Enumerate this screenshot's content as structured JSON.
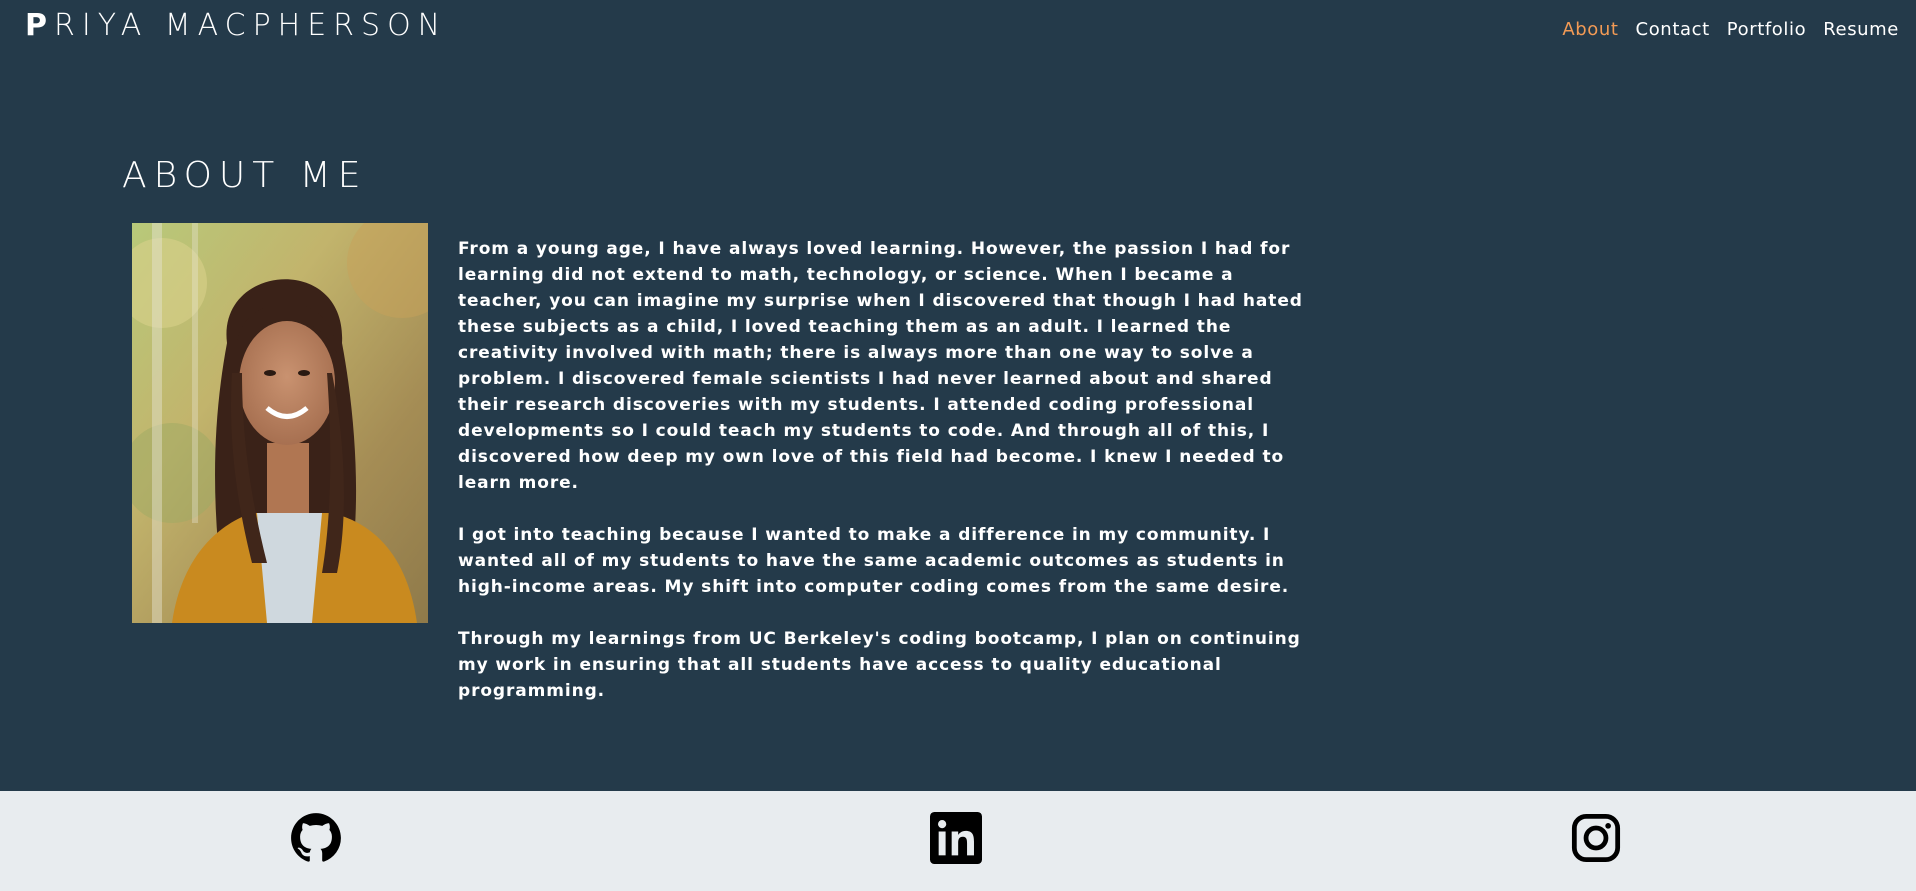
{
  "header": {
    "brand_initial": "P",
    "brand_rest": "RIYA MACPHERSON",
    "nav": [
      {
        "label": "About",
        "active": true
      },
      {
        "label": "Contact",
        "active": false
      },
      {
        "label": "Portfolio",
        "active": false
      },
      {
        "label": "Resume",
        "active": false
      }
    ]
  },
  "main": {
    "title": "ABOUT ME",
    "paragraphs": [
      "From a young age, I have always loved learning. However, the passion I had for learning did not extend to math, technology, or science. When I became a teacher, you can imagine my surprise when I discovered that though I had hated these subjects as a child, I loved teaching them as an adult. I learned the creativity involved with math; there is always more than one way to solve a problem. I discovered female scientists I had never learned about and shared their research discoveries with my students. I attended coding professional developments so I could teach my students to code. And through all of this, I discovered how deep my own love of this field had become. I knew I needed to learn more.",
      "I got into teaching because I wanted to make a difference in my community. I wanted all of my students to have the same academic outcomes as students in high-income areas. My shift into computer coding comes from the same desire.",
      "Through my learnings from UC Berkeley's coding bootcamp, I plan on continuing my work in ensuring that all students have access to quality educational programming."
    ]
  },
  "footer": {
    "icons": [
      "github-icon",
      "linkedin-icon",
      "instagram-icon"
    ]
  },
  "colors": {
    "background": "#243a4a",
    "accent": "#f29a55",
    "footer": "#e8ecef",
    "text": "#ffffff"
  }
}
